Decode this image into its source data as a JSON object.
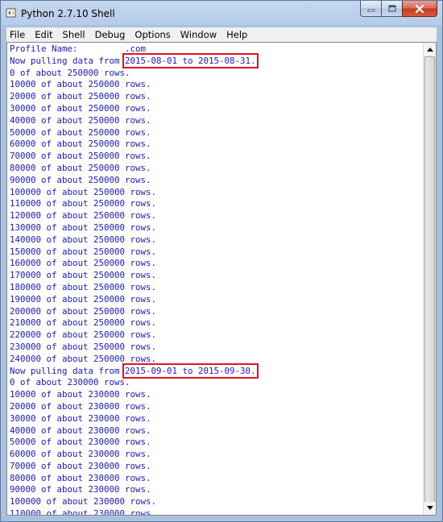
{
  "window": {
    "title": "Python 2.7.10 Shell",
    "icon": "python-idle-icon"
  },
  "caption_buttons": {
    "minimize_icon": "minimize-icon",
    "maximize_icon": "maximize-icon",
    "close_icon": "close-icon"
  },
  "menu": [
    "File",
    "Edit",
    "Shell",
    "Debug",
    "Options",
    "Window",
    "Help"
  ],
  "shell": {
    "text_color": "#1a1acc",
    "highlight_color": "#e3141e",
    "lines": [
      {
        "text": "Profile Name:         .com"
      },
      {
        "prefix": "Now pulling data from ",
        "highlight": "2015-08-01 to 2015-08-31."
      },
      {
        "text": "0 of about 250000 rows."
      },
      {
        "text": "10000 of about 250000 rows."
      },
      {
        "text": "20000 of about 250000 rows."
      },
      {
        "text": "30000 of about 250000 rows."
      },
      {
        "text": "40000 of about 250000 rows."
      },
      {
        "text": "50000 of about 250000 rows."
      },
      {
        "text": "60000 of about 250000 rows."
      },
      {
        "text": "70000 of about 250000 rows."
      },
      {
        "text": "80000 of about 250000 rows."
      },
      {
        "text": "90000 of about 250000 rows."
      },
      {
        "text": "100000 of about 250000 rows."
      },
      {
        "text": "110000 of about 250000 rows."
      },
      {
        "text": "120000 of about 250000 rows."
      },
      {
        "text": "130000 of about 250000 rows."
      },
      {
        "text": "140000 of about 250000 rows."
      },
      {
        "text": "150000 of about 250000 rows."
      },
      {
        "text": "160000 of about 250000 rows."
      },
      {
        "text": "170000 of about 250000 rows."
      },
      {
        "text": "180000 of about 250000 rows."
      },
      {
        "text": "190000 of about 250000 rows."
      },
      {
        "text": "200000 of about 250000 rows."
      },
      {
        "text": "210000 of about 250000 rows."
      },
      {
        "text": "220000 of about 250000 rows."
      },
      {
        "text": "230000 of about 250000 rows."
      },
      {
        "text": "240000 of about 250000 rows."
      },
      {
        "prefix": "Now pulling data from ",
        "highlight": "2015-09-01 to 2015-09-30."
      },
      {
        "text": "0 of about 230000 rows."
      },
      {
        "text": "10000 of about 230000 rows."
      },
      {
        "text": "20000 of about 230000 rows."
      },
      {
        "text": "30000 of about 230000 rows."
      },
      {
        "text": "40000 of about 230000 rows."
      },
      {
        "text": "50000 of about 230000 rows."
      },
      {
        "text": "60000 of about 230000 rows."
      },
      {
        "text": "70000 of about 230000 rows."
      },
      {
        "text": "80000 of about 230000 rows."
      },
      {
        "text": "90000 of about 230000 rows."
      },
      {
        "text": "100000 of about 230000 rows."
      },
      {
        "text": "110000 of about 230000 rows."
      }
    ]
  },
  "scrollbar": {
    "up_icon": "scroll-up-arrow-icon",
    "down_icon": "scroll-down-arrow-icon",
    "position": 0.97
  }
}
